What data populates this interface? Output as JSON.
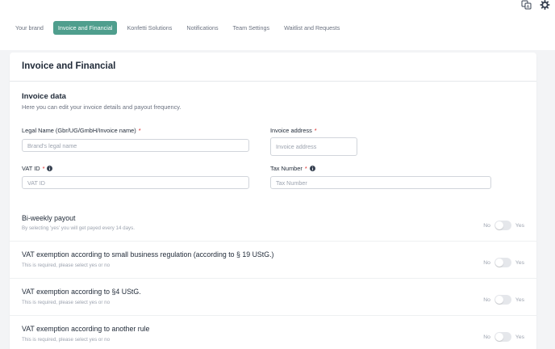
{
  "tabs": [
    {
      "label": "Your brand",
      "active": false
    },
    {
      "label": "Invoice and Financial",
      "active": true
    },
    {
      "label": "Konfetti Solutions",
      "active": false
    },
    {
      "label": "Notifications",
      "active": false
    },
    {
      "label": "Team Settings",
      "active": false
    },
    {
      "label": "Waitlist and Requests",
      "active": false
    }
  ],
  "top_icons": [
    "translate-icon",
    "gear-icon"
  ],
  "accent_color": "#4f9e8d",
  "card": {
    "title": "Invoice and Financial",
    "section_title": "Invoice data",
    "section_subtitle": "Here you can edit your invoice details and payout frequency.",
    "fields": {
      "legal_name": {
        "label": "Legal Name (Gbr/UG/GmbH/Invoice name)",
        "required": "*",
        "placeholder": "Brand's legal name"
      },
      "invoice_address": {
        "label": "Invoice address",
        "required": "*",
        "placeholder": "Invoice address"
      },
      "vat_id": {
        "label": "VAT ID",
        "required": "*",
        "placeholder": "VAT ID"
      },
      "tax_number": {
        "label": "Tax Number",
        "required": "*",
        "placeholder": "Tax Number"
      }
    },
    "toggles": [
      {
        "title": "Bi-weekly payout",
        "subtitle": "By selecting 'yes' you will get payed every 14 days.",
        "no": "No",
        "yes": "Yes",
        "value": "No"
      },
      {
        "title": "VAT exemption according to small business regulation (according to § 19 UStG.)",
        "subtitle": "This is required, please select yes or no",
        "no": "No",
        "yes": "Yes",
        "value": "No"
      },
      {
        "title": "VAT exemption according to §4 UStG.",
        "subtitle": "This is required, please select yes or no",
        "no": "No",
        "yes": "Yes",
        "value": "No"
      },
      {
        "title": "VAT exemption according to another rule",
        "subtitle": "This is required, please select yes or no",
        "no": "No",
        "yes": "Yes",
        "value": "No"
      }
    ]
  }
}
